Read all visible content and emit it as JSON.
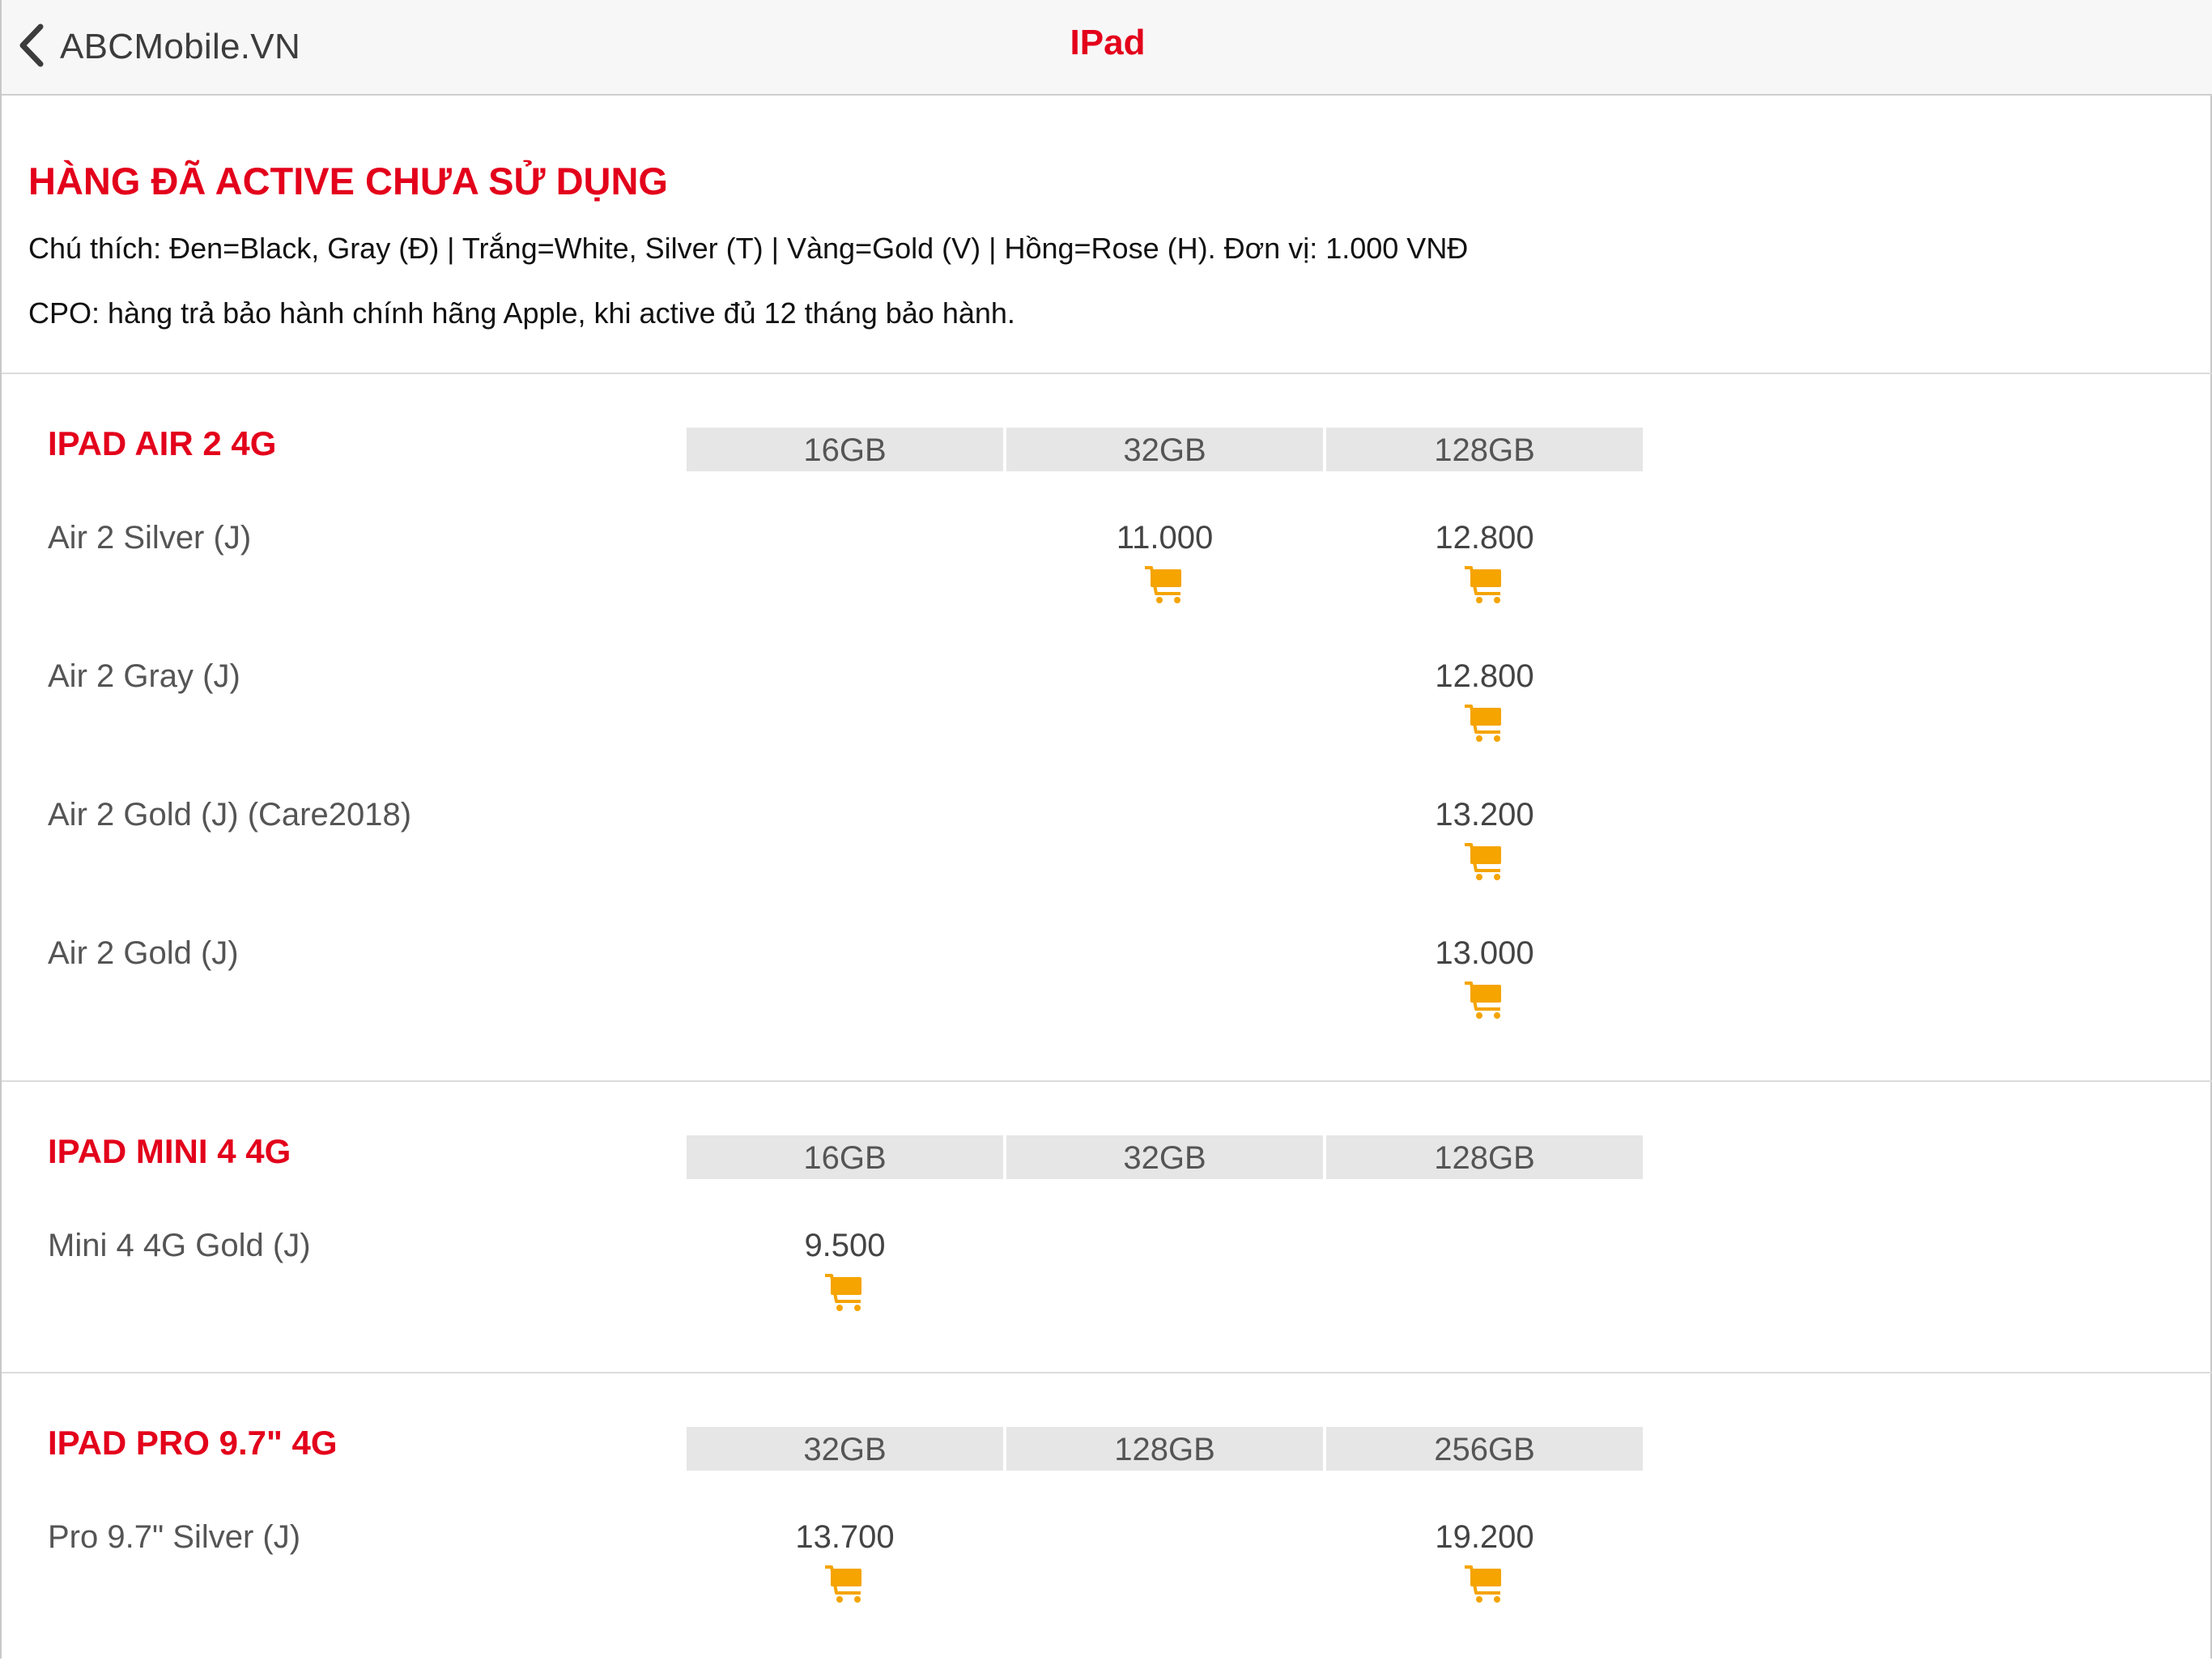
{
  "nav": {
    "back_label": "ABCMobile.VN",
    "title": "IPad"
  },
  "intro": {
    "title": "HÀNG ĐÃ ACTIVE CHƯA SỬ DỤNG",
    "legend": "Chú thích: Đen=Black, Gray (Đ) | Trắng=White, Silver (T) | Vàng=Gold (V) | Hồng=Rose (H). Đơn vị: 1.000 VNĐ",
    "cpo_note": "CPO: hàng trả bảo hành chính hãng Apple, khi active đủ 12 tháng bảo hành."
  },
  "colors": {
    "accent": "#e3001b",
    "cart": "#f5a400"
  },
  "sections": [
    {
      "title": "IPAD AIR 2 4G",
      "capacities": [
        "16GB",
        "32GB",
        "128GB"
      ],
      "rows": [
        {
          "name": "Air 2 Silver (J)",
          "prices": [
            "",
            "11.000",
            "12.800"
          ]
        },
        {
          "name": "Air 2 Gray (J)",
          "prices": [
            "",
            "",
            "12.800"
          ]
        },
        {
          "name": "Air 2 Gold (J) (Care2018)",
          "prices": [
            "",
            "",
            "13.200"
          ]
        },
        {
          "name": "Air 2 Gold (J)",
          "prices": [
            "",
            "",
            "13.000"
          ]
        }
      ]
    },
    {
      "title": "IPAD MINI 4 4G",
      "capacities": [
        "16GB",
        "32GB",
        "128GB"
      ],
      "rows": [
        {
          "name": "Mini 4 4G Gold (J)",
          "prices": [
            "9.500",
            "",
            ""
          ]
        }
      ]
    },
    {
      "title": "IPAD PRO 9.7\" 4G",
      "capacities": [
        "32GB",
        "128GB",
        "256GB"
      ],
      "rows": [
        {
          "name": "Pro 9.7\" Silver (J)",
          "prices": [
            "13.700",
            "",
            "19.200"
          ]
        }
      ]
    }
  ]
}
